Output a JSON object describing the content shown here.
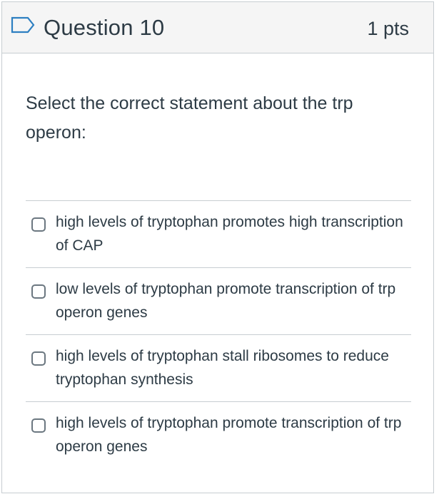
{
  "header": {
    "title": "Question 10",
    "points": "1 pts",
    "flag_icon": "flag-outline-icon"
  },
  "question": {
    "text": "Select the correct statement about the trp operon:"
  },
  "answers": [
    {
      "label": "high levels of tryptophan promotes high transcription of CAP",
      "selected": false
    },
    {
      "label": "low levels of tryptophan promote transcription of trp operon genes",
      "selected": false
    },
    {
      "label": "high levels of tryptophan stall ribosomes to reduce tryptophan synthesis",
      "selected": false
    },
    {
      "label": "high levels of tryptophan promote transcription of trp operon genes",
      "selected": false
    }
  ],
  "colors": {
    "text": "#2d3b45",
    "border": "#c7cdd1",
    "header_bg": "#f5f5f5",
    "flag_stroke": "#2d7fc1"
  }
}
